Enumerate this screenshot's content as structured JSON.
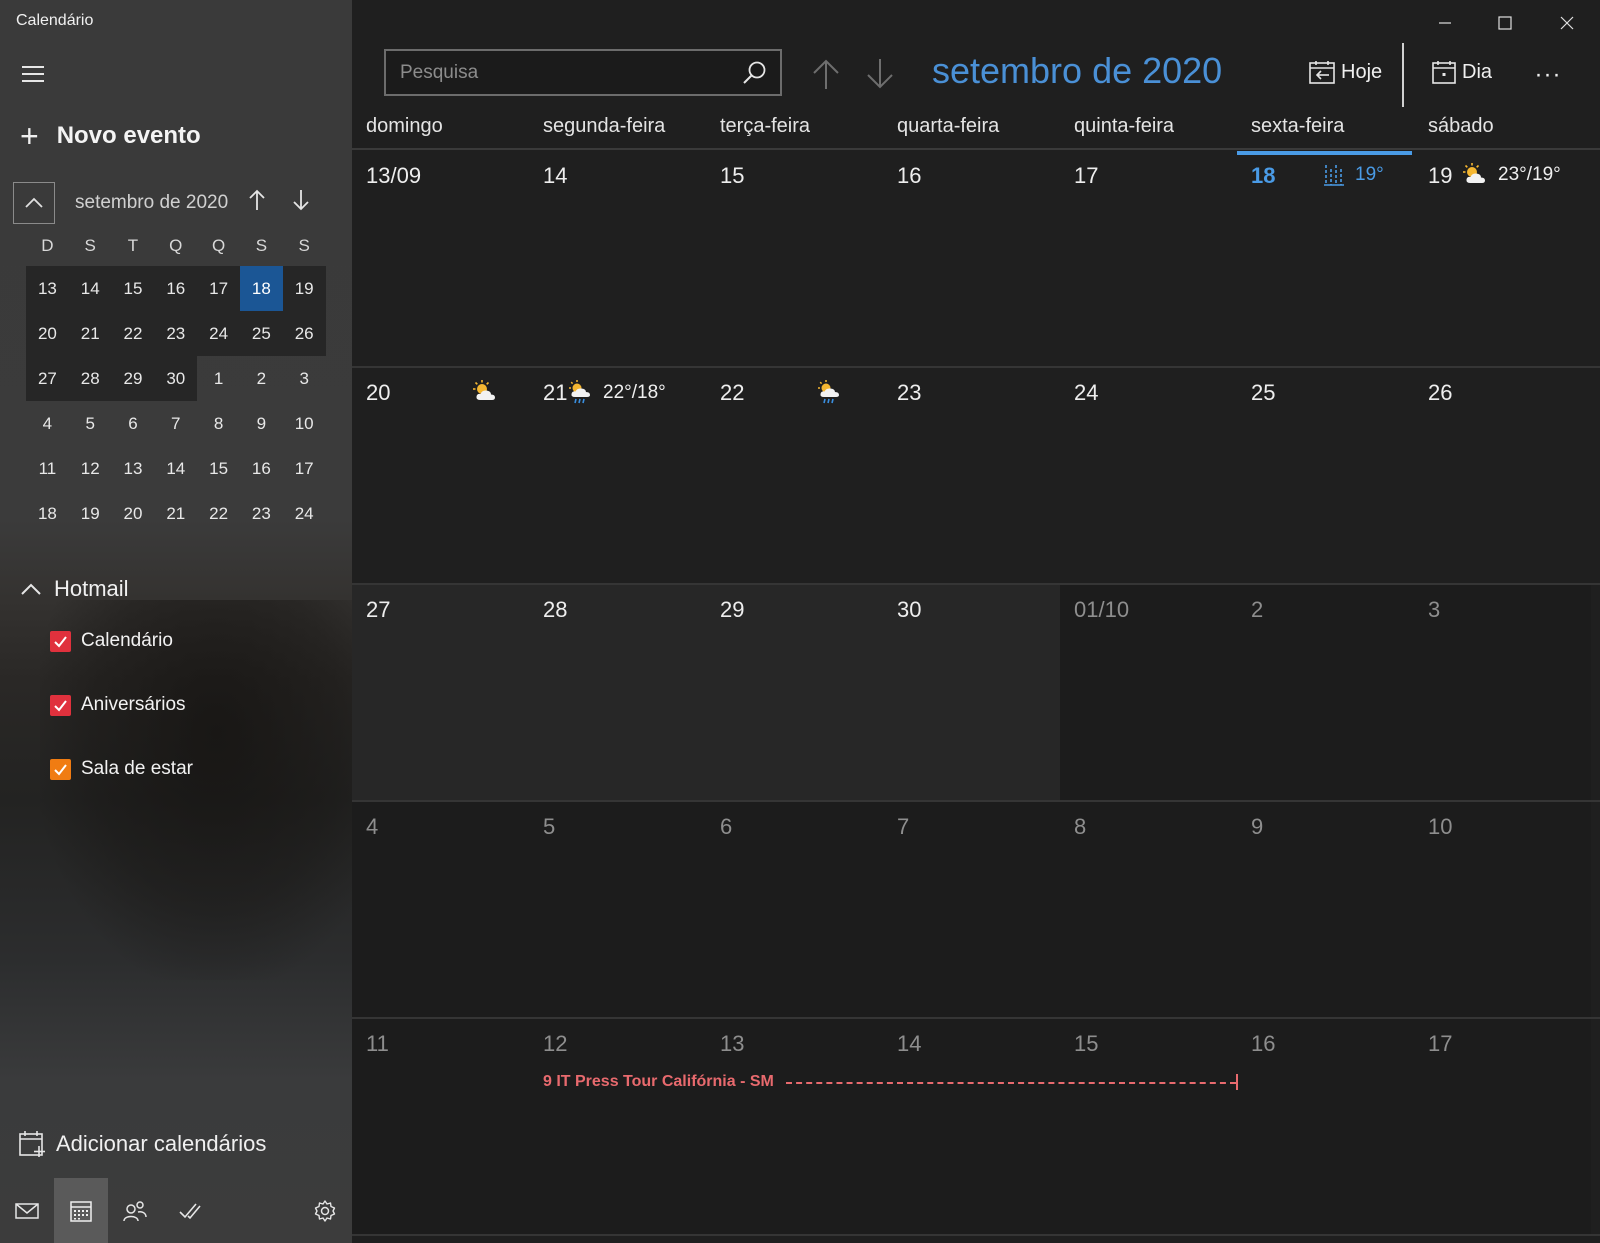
{
  "app_title": "Calendário",
  "sidebar": {
    "new_event_label": "Novo evento",
    "mini_calendar": {
      "title": "setembro de 2020",
      "dow": [
        "D",
        "S",
        "T",
        "Q",
        "Q",
        "S",
        "S"
      ],
      "weeks": [
        [
          "13",
          "14",
          "15",
          "16",
          "17",
          "18",
          "19"
        ],
        [
          "20",
          "21",
          "22",
          "23",
          "24",
          "25",
          "26"
        ],
        [
          "27",
          "28",
          "29",
          "30",
          "1",
          "2",
          "3"
        ],
        [
          "4",
          "5",
          "6",
          "7",
          "8",
          "9",
          "10"
        ],
        [
          "11",
          "12",
          "13",
          "14",
          "15",
          "16",
          "17"
        ],
        [
          "18",
          "19",
          "20",
          "21",
          "22",
          "23",
          "24"
        ]
      ],
      "today": "18"
    },
    "account": "Hotmail",
    "calendars": [
      {
        "label": "Calendário",
        "color": "#e0313d"
      },
      {
        "label": "Aniversários",
        "color": "#e0313d"
      },
      {
        "label": "Sala de estar",
        "color": "#f07c12"
      }
    ],
    "add_calendars_label": "Adicionar calendários"
  },
  "toolbar": {
    "search_placeholder": "Pesquisa",
    "month_title": "setembro de 2020",
    "today_label": "Hoje",
    "day_label": "Dia",
    "more_label": "···"
  },
  "colors": {
    "accent": "#4a90d6",
    "today": "#1b5695",
    "event": "#e86a6e"
  },
  "weekdays": [
    "domingo",
    "segunda-feira",
    "terça-feira",
    "quarta-feira",
    "quinta-feira",
    "sexta-feira",
    "sábado"
  ],
  "weeks": [
    [
      "13/09",
      "14",
      "15",
      "16",
      "17",
      "18",
      "19"
    ],
    [
      "20",
      "21",
      "22",
      "23",
      "24",
      "25",
      "26"
    ],
    [
      "27",
      "28",
      "29",
      "30",
      "01/10",
      "2",
      "3"
    ],
    [
      "4",
      "5",
      "6",
      "7",
      "8",
      "9",
      "10"
    ],
    [
      "11",
      "12",
      "13",
      "14",
      "15",
      "16",
      "17"
    ]
  ],
  "weather": {
    "fri18": "19°",
    "sat19": "23°/19°",
    "mon21": "22°/18°"
  },
  "event": {
    "title": "9 IT Press Tour Califórnia - SM"
  }
}
